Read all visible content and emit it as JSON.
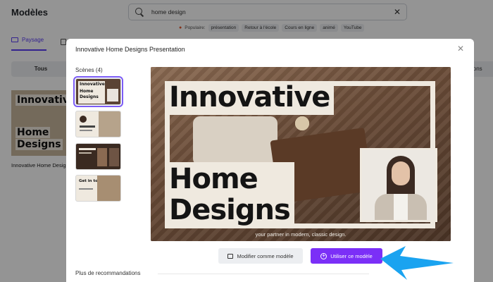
{
  "page": {
    "title": "Modèles",
    "search": {
      "query": "home design"
    },
    "popular": {
      "label": "Populaire:",
      "tags": [
        "présentation",
        "Retour à l'école",
        "Cours en ligne",
        "animé",
        "YouTube"
      ]
    },
    "tabs": {
      "active": "Paysage"
    },
    "filters": {
      "all": "Tous",
      "right_partial": "ions"
    },
    "bg_card": {
      "caption": "Innovative Home Desig",
      "thumb_lines": [
        "Innovative",
        "Home",
        "Designs"
      ]
    }
  },
  "modal": {
    "title": "Innovative Home Designs Presentation",
    "scenes_label": "Scènes (4)",
    "scenes": [
      {
        "lines": [
          "Innovative",
          "Home",
          "Designs"
        ]
      },
      {
        "lines": []
      },
      {
        "lines": []
      },
      {
        "lines": [
          "Get in touch"
        ]
      }
    ],
    "preview": {
      "title_line1": "Innovative",
      "title_line2": "Home",
      "title_line3": "Designs",
      "subtitle": "your partner in modern, classic design."
    },
    "buttons": {
      "edit": "Modifier comme modèle",
      "use": "Utiliser ce modèle"
    },
    "more_recommendations": "Plus de recommandations"
  },
  "colors": {
    "accent": "#7b2ff7",
    "arrow": "#1aa3f0",
    "panel_beige": "#efe9df"
  },
  "icons": {
    "search": "search-icon",
    "clear": "close-icon",
    "popular": "fire-icon",
    "landscape": "laptop-icon",
    "modal_close": "close-icon",
    "edit": "template-icon",
    "use": "plus-circle-icon"
  }
}
